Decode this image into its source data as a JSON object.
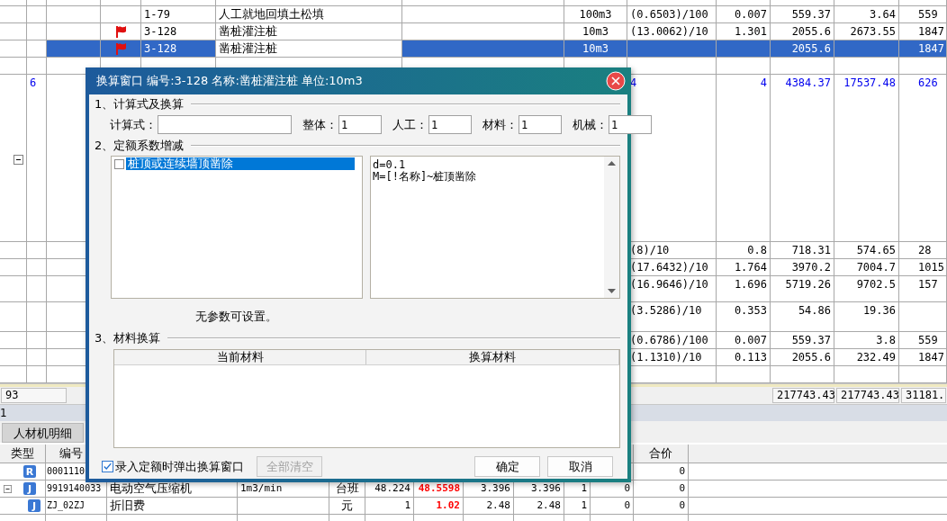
{
  "grid": {
    "rows": [
      {
        "kind": "item",
        "flag": false,
        "selected": false
      },
      {
        "kind": "item",
        "flag": false,
        "selected": false,
        "cells": {
          "column_5": "1-79",
          "column_6": "人工就地回填土松填",
          "column_8": "100m3",
          "column_9": "(0.6503)/100",
          "column_10": "0.007",
          "column_11": "559.37",
          "column_12": "3.64",
          "column_13": "559"
        }
      },
      {
        "kind": "item",
        "flag": true,
        "selected": false,
        "cells": {
          "column_5": "3-128",
          "column_6": "凿桩灌注桩",
          "column_8": "10m3",
          "column_9": "(13.0062)/10",
          "column_10": "1.301",
          "column_11": "2055.6",
          "column_12": "2673.55",
          "column_13": "1847"
        }
      },
      {
        "kind": "item",
        "flag": true,
        "selected": true,
        "editing": true,
        "cells": {
          "column_5": "3-128",
          "column_6": "凿桩灌注桩",
          "column_8": "10m3",
          "column_11": "2055.6",
          "column_13": "1847"
        }
      },
      {
        "kind": "item",
        "flag": false,
        "selected": false
      },
      {
        "kind": "group",
        "expanded": true,
        "flag": false,
        "selected": false,
        "cells": {
          "column_2": "6",
          "column_9": "4",
          "column_10": "4",
          "column_11": "4384.37",
          "column_12": "17537.48",
          "column_13": "626"
        }
      },
      {
        "kind": "item",
        "flag": false,
        "selected": false,
        "cells": {
          "column_9": "(8)/10",
          "column_10": "0.8",
          "column_11": "718.31",
          "column_12": "574.65",
          "column_13": "28"
        }
      },
      {
        "kind": "item",
        "flag": false,
        "selected": false,
        "cells": {
          "column_9": "(17.6432)/10",
          "column_10": "1.764",
          "column_11": "3970.2",
          "column_12": "7004.7",
          "column_13": "1015"
        }
      },
      {
        "kind": "item",
        "flag": false,
        "selected": false,
        "cells": {
          "column_9": "(16.9646)/10",
          "column_10": "1.696",
          "column_11": "5719.26",
          "column_12": "9702.5",
          "column_13": "157"
        }
      },
      {
        "kind": "item",
        "flag": false,
        "selected": false,
        "cells": {
          "column_9": "(3.5286)/10",
          "column_10": "0.353",
          "column_11": "54.86",
          "column_12": "19.36"
        }
      },
      {
        "kind": "item",
        "flag": false,
        "selected": false,
        "cells": {
          "column_9": "(0.6786)/100",
          "column_10": "0.007",
          "column_11": "559.37",
          "column_12": "3.8",
          "column_13": "559"
        }
      },
      {
        "kind": "item",
        "flag": false,
        "selected": false,
        "cells": {
          "column_9": "(1.1310)/10",
          "column_10": "0.113",
          "column_11": "2055.6",
          "column_12": "232.49",
          "column_13": "1847"
        }
      },
      {
        "kind": "item",
        "flag": false,
        "selected": false
      }
    ]
  },
  "summary": {
    "count": "93",
    "column_11": "217743.43",
    "column_12": "217743.43",
    "column_13": "31181."
  },
  "status_bar": {
    "text": "1"
  },
  "bottom_tabs": [
    {
      "label": "人材机明细",
      "selected": true
    }
  ],
  "detail_table": {
    "columns": {
      "column_1": "类型",
      "column_2": "编号",
      "column_12": "合价"
    },
    "rows": [
      {
        "kind": "item",
        "badge": "R",
        "cells": {
          "column_2": "0001110",
          "column_12": "0"
        }
      },
      {
        "kind": "parent",
        "expanded": true,
        "badge": "J",
        "adjusted": true,
        "cells": {
          "column_2": "9919140033",
          "column_3": "电动空气压缩机",
          "column_4": "1m3/min",
          "column_5": "台班",
          "column_6": "48.224",
          "column_7": "48.5598",
          "column_8": "3.396",
          "column_9": "3.396",
          "column_10": "1",
          "column_11": "0",
          "column_12": "0"
        }
      },
      {
        "kind": "child",
        "badge": "J",
        "adjusted": true,
        "cells": {
          "column_2": "ZJ_02ZJ",
          "column_3": "折旧费",
          "column_5": "元",
          "column_6": "1",
          "column_7": "1.02",
          "column_8": "2.48",
          "column_9": "2.48",
          "column_10": "1",
          "column_11": "0",
          "column_12": "0"
        }
      },
      {
        "kind": "child"
      }
    ]
  },
  "dialog": {
    "title": "换算窗口 编号:3-128 名称:凿桩灌注桩 单位:10m3",
    "section_1": {
      "heading": "1、计算式及换算",
      "fields": [
        {
          "label": "计算式："
        },
        {
          "label": "整体：",
          "value": "1"
        },
        {
          "label": "人工：",
          "value": "1"
        },
        {
          "label": "材料：",
          "value": "1"
        },
        {
          "label": "机械：",
          "value": "1"
        }
      ]
    },
    "section_2": {
      "heading": "2、定额系数增减",
      "options": [
        {
          "label": "桩顶或连续墙顶凿除",
          "checked": false,
          "selected": true
        }
      ],
      "formula_lines": [
        "d=0.1",
        "M=[!名称]~桩顶凿除"
      ],
      "note": "无参数可设置。"
    },
    "section_3": {
      "heading": "3、材料换算",
      "columns": [
        "当前材料",
        "换算材料"
      ]
    },
    "popup_option": {
      "label": "录入定额时弹出换算窗口",
      "checked": true
    },
    "buttons": [
      {
        "label": "全部清空",
        "disabled": true
      },
      {
        "label": "确定",
        "disabled": false
      },
      {
        "label": "取消",
        "disabled": false
      }
    ]
  }
}
